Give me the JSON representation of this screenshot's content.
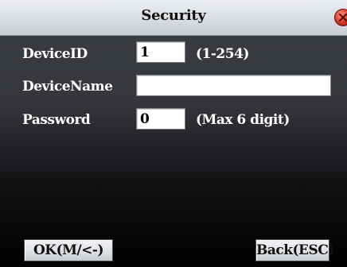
{
  "window": {
    "title": "Security"
  },
  "form": {
    "device_id": {
      "label": "DeviceID",
      "value": "1",
      "hint": "(1-254)"
    },
    "device_name": {
      "label": "DeviceName",
      "value": ""
    },
    "password": {
      "label": "Password",
      "value": "0",
      "hint": "(Max 6 digit)"
    }
  },
  "footer": {
    "ok_label": "OK(M/<-)",
    "back_label": "Back(ESC)"
  },
  "colors": {
    "accent": "#d2321f",
    "background": "#34363b"
  },
  "icons": {
    "close": "close-icon"
  }
}
